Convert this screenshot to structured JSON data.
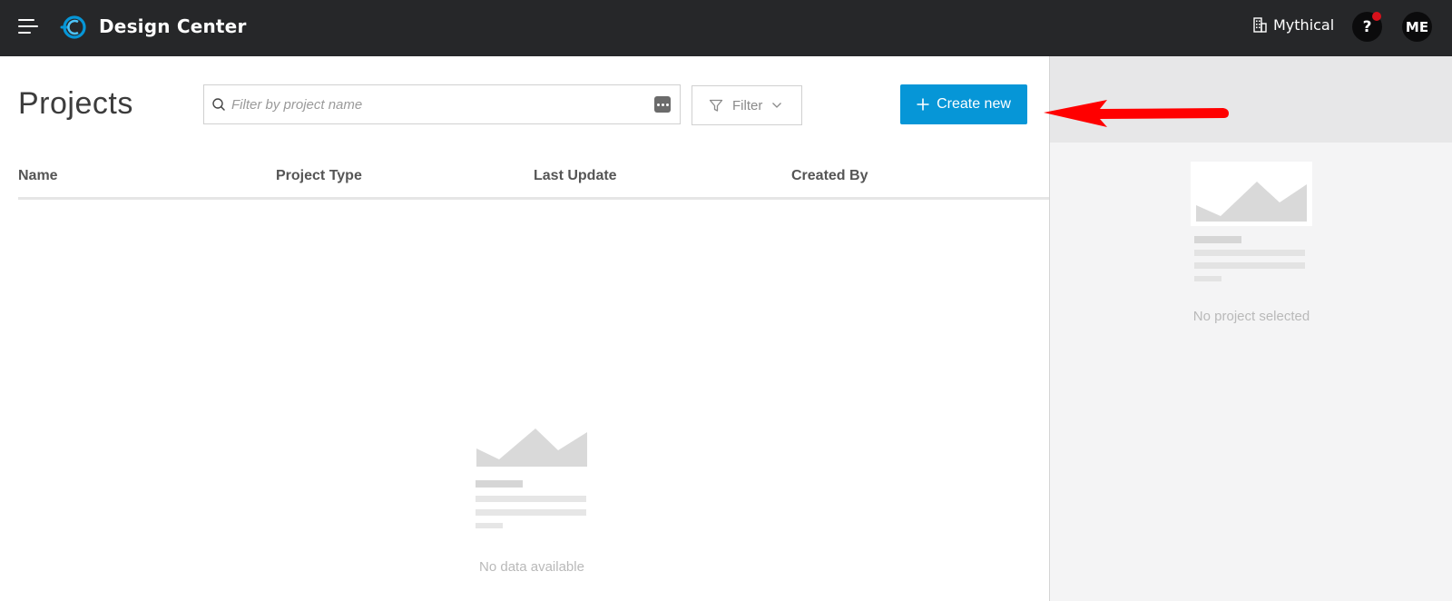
{
  "app": {
    "title": "Design Center",
    "account_name": "Mythical",
    "help_label": "?",
    "avatar_initials": "ME"
  },
  "main": {
    "title": "Projects",
    "search": {
      "placeholder": "Filter by project name",
      "value": ""
    },
    "filter_label": "Filter",
    "create_label": "Create new",
    "columns": [
      "Name",
      "Project Type",
      "Last Update",
      "Created By"
    ],
    "empty_text": "No data available"
  },
  "panel": {
    "empty_text": "No project selected"
  },
  "colors": {
    "topbar": "#262729",
    "accent": "#0696d7",
    "annotation_arrow": "#ff0000",
    "notification_dot": "#d8111b"
  },
  "icons": {
    "menu": "hamburger-icon",
    "logo": "design-center-logo",
    "account": "building-icon",
    "search": "search-icon",
    "more": "more-options-icon",
    "filter": "filter-icon",
    "chevron": "chevron-down-icon",
    "plus": "plus-icon"
  }
}
